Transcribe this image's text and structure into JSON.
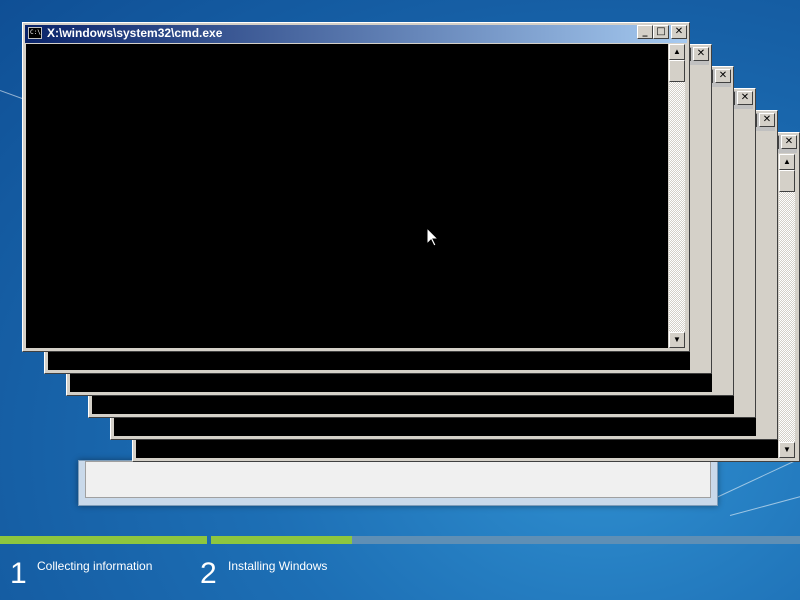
{
  "cmd_window": {
    "title": "X:\\windows\\system32\\cmd.exe",
    "icon_text": "C:\\",
    "minimize_glyph": "_",
    "maximize_glyph": "□",
    "close_glyph": "✕"
  },
  "steps": [
    {
      "number": "1",
      "label": "Collecting information",
      "progress": 1.0
    },
    {
      "number": "2",
      "label": "Installing Windows",
      "progress": 0.24
    }
  ],
  "colors": {
    "progress_fill": "#8dc63f",
    "progress_track": "#5f8fb5",
    "console_background": "#000000"
  }
}
